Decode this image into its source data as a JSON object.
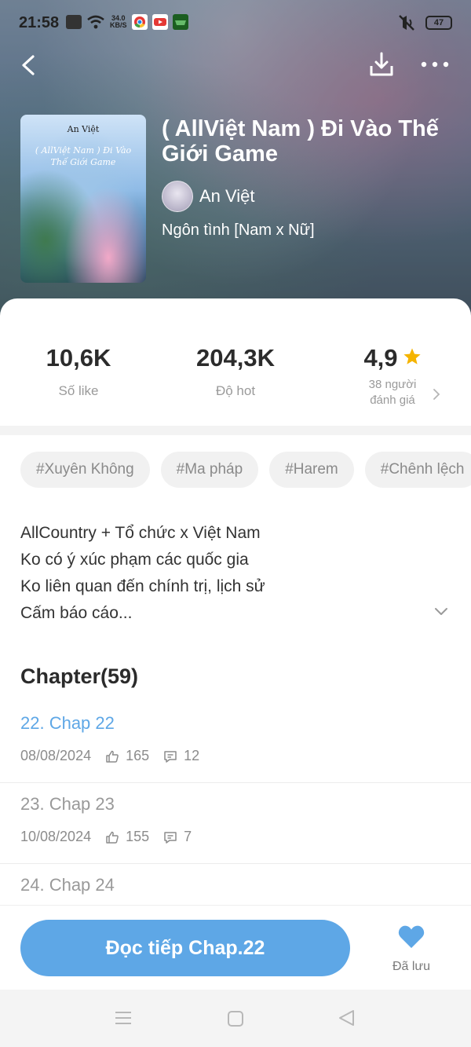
{
  "status_bar": {
    "time": "21:58",
    "speed_value": "34.0",
    "speed_unit": "KB/S",
    "battery": "47"
  },
  "book": {
    "title": "( AllViệt Nam ) Đi Vào Thế Giới Game",
    "author": "An Việt",
    "genre": "Ngôn tình [Nam x Nữ]",
    "cover_author": "An Việt",
    "cover_title": "( AllViệt Nam ) Đi Vào Thế Giới Game"
  },
  "stats": {
    "likes_value": "10,6K",
    "likes_label": "Số like",
    "hot_value": "204,3K",
    "hot_label": "Độ hot",
    "rating_value": "4,9",
    "rating_label_line1": "38 người",
    "rating_label_line2": "đánh giá"
  },
  "tags": [
    "#Xuyên Không",
    "#Ma pháp",
    "#Harem",
    "#Chênh lệch"
  ],
  "description": {
    "line1": "AllCountry + Tổ chức x Việt Nam",
    "line2": "Ko có ý xúc phạm các quốc gia",
    "line3": "Ko liên quan đến chính trị, lịch sử",
    "line4": "Cấm báo cáo..."
  },
  "chapters": {
    "heading": "Chapter(59)",
    "items": [
      {
        "title": "22. Chap 22",
        "date": "08/08/2024",
        "likes": "165",
        "comments": "12"
      },
      {
        "title": "23. Chap 23",
        "date": "10/08/2024",
        "likes": "155",
        "comments": "7"
      },
      {
        "title": "24. Chap 24"
      }
    ]
  },
  "actions": {
    "read_label": "Đọc tiếp Chap.22",
    "saved_label": "Đã lưu"
  },
  "colors": {
    "accent": "#5ea7e6",
    "star": "#f5b400"
  }
}
